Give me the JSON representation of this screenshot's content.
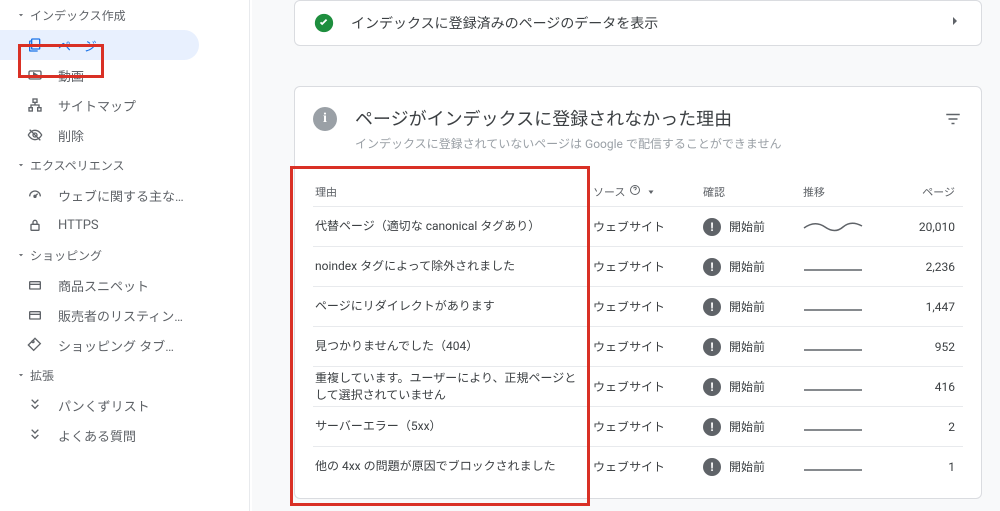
{
  "sidebar": {
    "sections": [
      {
        "label": "インデックス作成",
        "items": [
          {
            "id": "pages",
            "icon": "pages",
            "label": "ページ",
            "active": true
          },
          {
            "id": "videos",
            "icon": "video",
            "label": "動画"
          },
          {
            "id": "sitemaps",
            "icon": "sitemap",
            "label": "サイトマップ"
          },
          {
            "id": "removals",
            "icon": "eye-off",
            "label": "削除"
          }
        ]
      },
      {
        "label": "エクスペリエンス",
        "items": [
          {
            "id": "cwv",
            "icon": "speed",
            "label": "ウェブに関する主な指標"
          },
          {
            "id": "https",
            "icon": "lock",
            "label": "HTTPS"
          }
        ]
      },
      {
        "label": "ショッピング",
        "items": [
          {
            "id": "snippets",
            "icon": "tag",
            "label": "商品スニペット"
          },
          {
            "id": "mlist",
            "icon": "store",
            "label": "販売者のリスティング"
          },
          {
            "id": "shoptab",
            "icon": "price",
            "label": "ショッピング タブのリス…"
          }
        ]
      },
      {
        "label": "拡張",
        "items": [
          {
            "id": "breadcrumb",
            "icon": "hier",
            "label": "パンくずリスト"
          },
          {
            "id": "faq",
            "icon": "hier",
            "label": "よくある質問"
          }
        ]
      }
    ]
  },
  "top_card": {
    "text": "インデックスに登録済みのページのデータを表示"
  },
  "card": {
    "title": "ページがインデックスに登録されなかった理由",
    "subtitle": "インデックスに登録されていないページは Google で配信することができません"
  },
  "table": {
    "headers": {
      "reason": "理由",
      "source": "ソース",
      "confirm": "確認",
      "trend": "推移",
      "pages": "ページ"
    },
    "rows": [
      {
        "reason": "代替ページ（適切な canonical タグあり）",
        "source": "ウェブサイト",
        "confirm": "開始前",
        "trend": "wave",
        "pages": "20,010"
      },
      {
        "reason": "noindex タグによって除外されました",
        "source": "ウェブサイト",
        "confirm": "開始前",
        "trend": "flat",
        "pages": "2,236"
      },
      {
        "reason": "ページにリダイレクトがあります",
        "source": "ウェブサイト",
        "confirm": "開始前",
        "trend": "flat",
        "pages": "1,447"
      },
      {
        "reason": "見つかりませんでした（404）",
        "source": "ウェブサイト",
        "confirm": "開始前",
        "trend": "flat",
        "pages": "952"
      },
      {
        "reason": "重複しています。ユーザーにより、正規ページとして選択されていません",
        "source": "ウェブサイト",
        "confirm": "開始前",
        "trend": "flat",
        "pages": "416"
      },
      {
        "reason": "サーバーエラー（5xx）",
        "source": "ウェブサイト",
        "confirm": "開始前",
        "trend": "flat",
        "pages": "2"
      },
      {
        "reason": "他の 4xx の問題が原因でブロックされました",
        "source": "ウェブサイト",
        "confirm": "開始前",
        "trend": "flat",
        "pages": "1"
      }
    ]
  }
}
